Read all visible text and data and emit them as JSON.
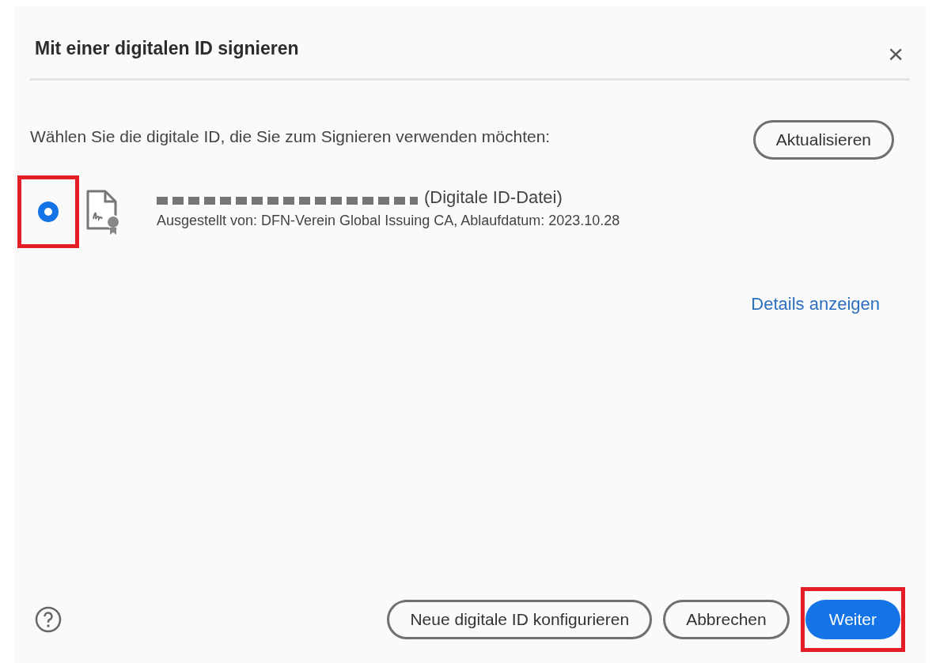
{
  "dialog": {
    "title": "Mit einer digitalen ID signieren",
    "close": "×"
  },
  "prompt": "Wählen Sie die digitale ID, die Sie zum Signieren verwenden möchten:",
  "refresh_button": "Aktualisieren",
  "ids": [
    {
      "selected": true,
      "highlighted": true,
      "name_redacted": true,
      "type": "(Digitale ID-Datei)",
      "details": "Ausgestellt von: DFN-Verein Global Issuing CA, Ablaufdatum: 2023.10.28"
    }
  ],
  "details_link": "Details anzeigen",
  "footer": {
    "buttons": [
      {
        "label": "Neue digitale ID konfigurieren",
        "kind": "outline",
        "highlighted": false
      },
      {
        "label": "Abbrechen",
        "kind": "outline",
        "highlighted": false
      },
      {
        "label": "Weiter",
        "kind": "primary",
        "highlighted": true
      }
    ]
  }
}
